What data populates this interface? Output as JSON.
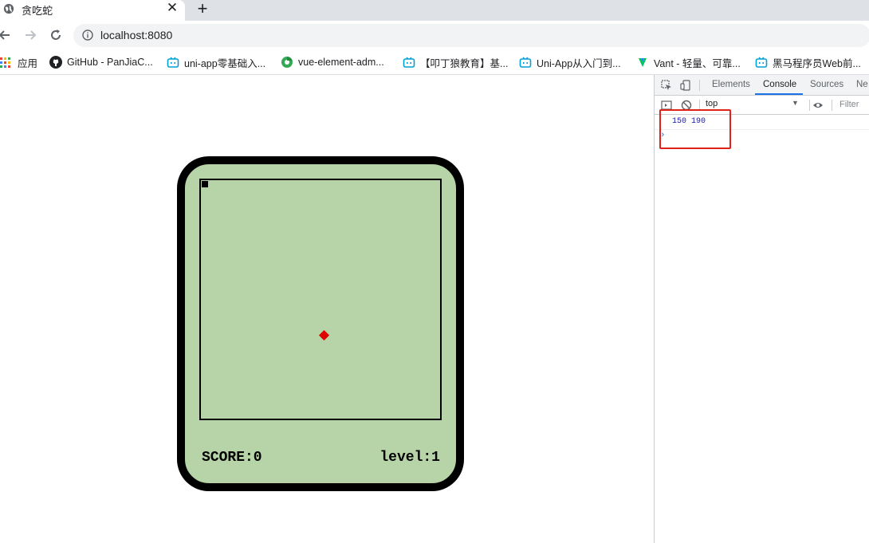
{
  "browser": {
    "tab": {
      "title": "贪吃蛇",
      "close_glyph": "✕"
    },
    "new_tab_glyph": "+",
    "url": "localhost:8080",
    "bookmarks": [
      {
        "label": "应用",
        "icon": "apps-grid-icon"
      },
      {
        "label": "GitHub - PanJiaC...",
        "icon": "github-icon"
      },
      {
        "label": "uni-app零基础入...",
        "icon": "bilibili-icon"
      },
      {
        "label": "vue-element-adm...",
        "icon": "chrome-web-icon"
      },
      {
        "label": "【叩丁狼教育】基...",
        "icon": "bilibili-icon"
      },
      {
        "label": "Uni-App从入门到...",
        "icon": "bilibili-icon"
      },
      {
        "label": "Vant - 轻量、可靠...",
        "icon": "vant-icon"
      },
      {
        "label": "黑马程序员Web前...",
        "icon": "bilibili-icon"
      }
    ]
  },
  "game": {
    "score_text": "SCORE:0",
    "level_text": "level:1",
    "food_color": "#e00000",
    "screen_color": "#b7d4a8"
  },
  "devtools": {
    "tabs": [
      "Elements",
      "Console",
      "Sources",
      "Ne"
    ],
    "active_tab": "Console",
    "context": "top",
    "filter_placeholder": "Filter",
    "log": "150 190",
    "prompt": "›",
    "highlight_color": "#e0201a"
  }
}
